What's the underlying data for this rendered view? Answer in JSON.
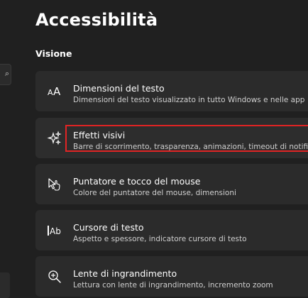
{
  "header": {
    "title": "Accessibilità"
  },
  "section": {
    "label": "Visione"
  },
  "items": [
    {
      "icon": "text-size-icon",
      "title": "Dimensioni del testo",
      "desc": "Dimensioni del testo visualizzato in tutto Windows e nelle app"
    },
    {
      "icon": "sparkle-icon",
      "title": "Effetti visivi",
      "desc": "Barre di scorrimento, trasparenza, animazioni, timeout di notifica"
    },
    {
      "icon": "mouse-pointer-icon",
      "title": "Puntatore e tocco del mouse",
      "desc": "Colore del puntatore del mouse, dimensioni"
    },
    {
      "icon": "text-cursor-icon",
      "title": "Cursore di testo",
      "desc": "Aspetto e spessore, indicatore cursore di testo"
    },
    {
      "icon": "magnifier-icon",
      "title": "Lente di ingrandimento",
      "desc": "Lettura con lente di ingrandimento, incremento zoom"
    }
  ],
  "colors": {
    "background": "#202020",
    "card": "#2b2b2b",
    "highlight": "#e02424"
  }
}
